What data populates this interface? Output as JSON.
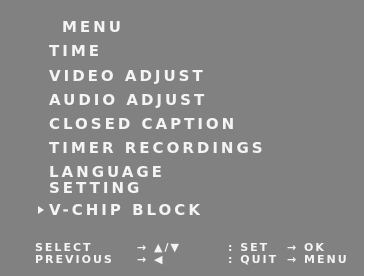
{
  "menu": {
    "title": "MENU",
    "items": [
      {
        "label": "TIME"
      },
      {
        "label": "VIDEO ADJUST"
      },
      {
        "label": "AUDIO ADJUST"
      },
      {
        "label": "CLOSED CAPTION"
      },
      {
        "label": "TIMER RECORDINGS"
      },
      {
        "label": "LANGUAGE"
      },
      {
        "label": "SETTING"
      },
      {
        "label": "V-CHIP BLOCK",
        "selected": true
      }
    ]
  },
  "footer": {
    "select_label": "SELECT",
    "select_keys": "→ ▲/▼",
    "set_label": ": SET",
    "set_target": "→ OK",
    "previous_label": "PREVIOUS",
    "previous_keys": "→ ◀",
    "quit_label": ": QUIT",
    "quit_target": "→ MENU"
  },
  "colors": {
    "background": "#818181",
    "text": "#f4f4f4"
  },
  "icons": {
    "selection_pointer": "triangle-right"
  }
}
